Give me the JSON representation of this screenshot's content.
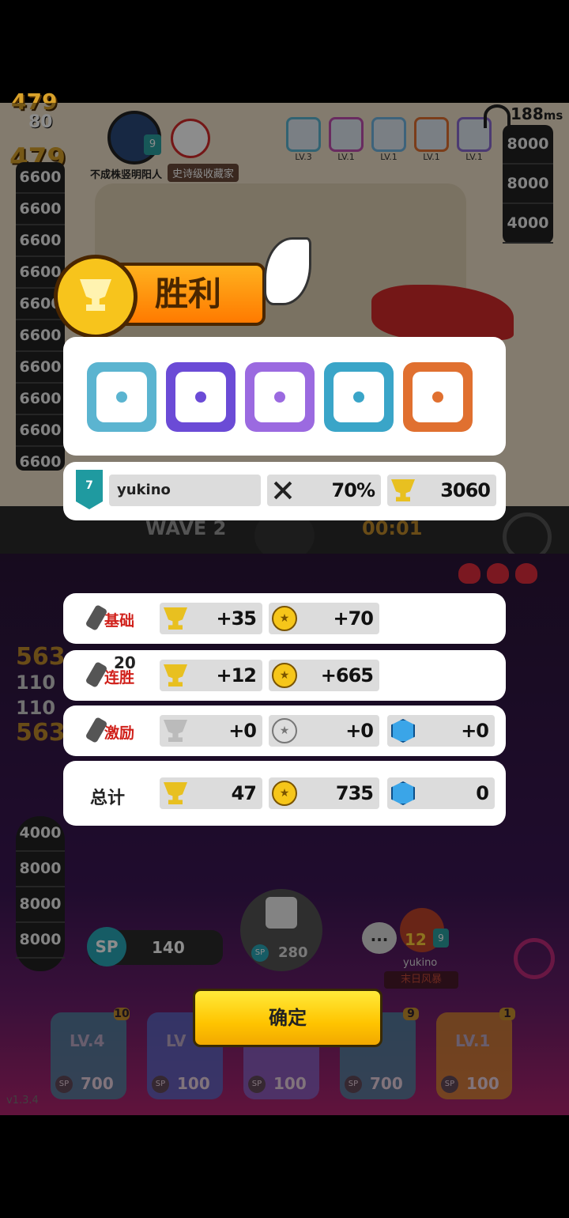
{
  "status_bar": {
    "ping": "188",
    "ping_unit": "ms"
  },
  "opponent": {
    "name": "不成株竖明阳人",
    "title": "史诗级收藏家",
    "level_badge": "9",
    "gold_counter": "479",
    "gold_counter_secondary": "80",
    "mini_cards": [
      {
        "label": "LV.3",
        "color": "#5bb4d0"
      },
      {
        "label": "LV.1",
        "color": "#c04fb0"
      },
      {
        "label": "LV.1",
        "color": "#6fb4e0"
      },
      {
        "label": "LV.1",
        "color": "#e07030"
      },
      {
        "label": "LV.1",
        "color": "#8a6ad0"
      }
    ],
    "left_column": [
      "6600",
      "6600",
      "6600",
      "6600",
      "6600",
      "6600",
      "6600",
      "6600",
      "6600",
      "6600"
    ],
    "right_column": [
      "8000",
      "8000",
      "4000"
    ]
  },
  "wave": {
    "label": "WAVE 2",
    "timer": "00:01"
  },
  "player": {
    "left_column": [
      "4000",
      "8000",
      "8000",
      "8000"
    ],
    "floating_numbers": [
      "563",
      "110",
      "110",
      "563"
    ],
    "sp": {
      "label": "SP",
      "value": "140"
    },
    "dice": {
      "sp_label": "SP",
      "cost": "280"
    },
    "name": "yukino",
    "level": "12",
    "level_badge": "9",
    "title": "末日风暴",
    "chat_icon": "...",
    "hand_cards": [
      {
        "level_label": "LV.4",
        "badge": "10",
        "cost": "700",
        "color": "#4f8fa8"
      },
      {
        "level_label": "LV",
        "badge": "",
        "cost": "100",
        "color": "#5c6fd0"
      },
      {
        "level_label": "",
        "badge": "",
        "cost": "100",
        "color": "#8a6ad0"
      },
      {
        "level_label": "4",
        "badge": "9",
        "cost": "700",
        "color": "#4f8fa8"
      },
      {
        "level_label": "LV.1",
        "badge": "1",
        "cost": "100",
        "color": "#e09030"
      }
    ],
    "hand_sp_label": "SP",
    "version": "v1.3.4"
  },
  "victory": {
    "title": "胜利"
  },
  "rewards": {
    "cards": [
      {
        "name": "vortex-card",
        "color": "#5bb4d0"
      },
      {
        "name": "blessing-card",
        "color": "#6b4bd6"
      },
      {
        "name": "purple-orb-card",
        "color": "#9b6ae0"
      },
      {
        "name": "frost-card",
        "color": "#3aa5c8"
      },
      {
        "name": "infinity-card",
        "color": "#e07030"
      }
    ]
  },
  "player_summary": {
    "level": "7",
    "name": "yukino",
    "win_rate": "70%",
    "trophies": "3060"
  },
  "breakdown": [
    {
      "label": "基础",
      "badge": "",
      "trophy": "+35",
      "coin": "+70",
      "gem": null,
      "active": true
    },
    {
      "label": "连胜",
      "badge": "20",
      "trophy": "+12",
      "coin": "+665",
      "gem": null,
      "active": true
    },
    {
      "label": "激励",
      "badge": "",
      "trophy": "+0",
      "coin": "+0",
      "gem": "+0",
      "active": false
    },
    {
      "label": "总计",
      "badge": "",
      "trophy": "47",
      "coin": "735",
      "gem": "0",
      "active": true
    }
  ],
  "confirm_button": {
    "label": "确定"
  },
  "colors": {
    "accent_yellow": "#ffc400",
    "victory_orange": "#ff8a00",
    "gem_blue": "#3aa5e8"
  }
}
